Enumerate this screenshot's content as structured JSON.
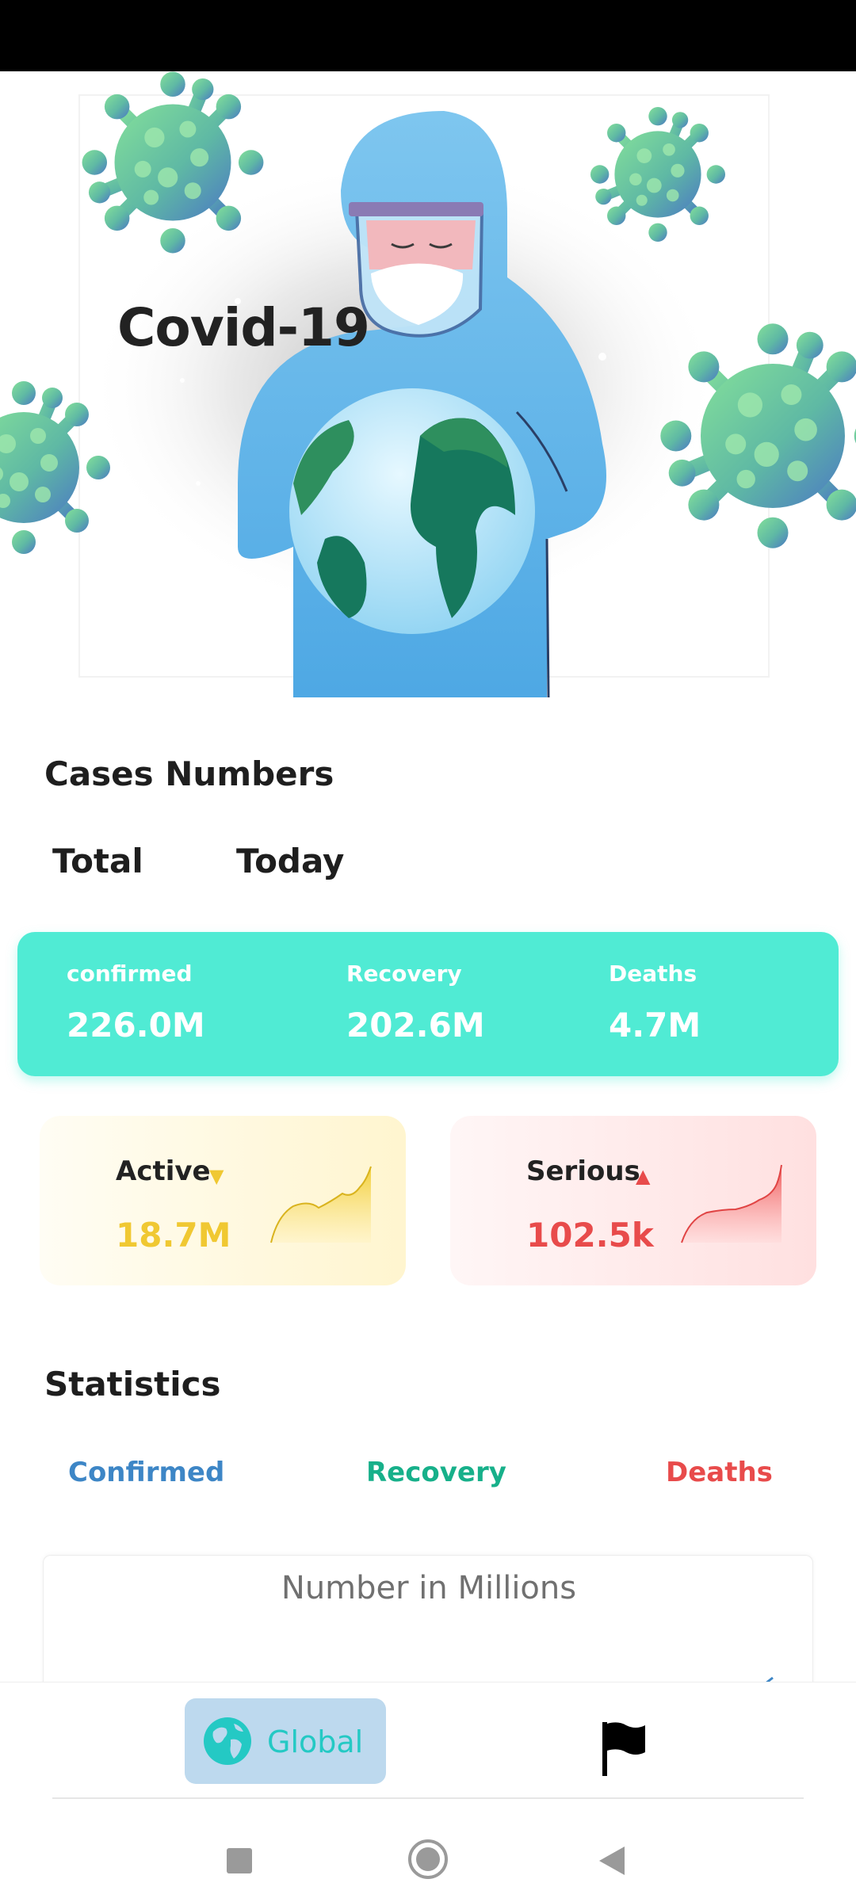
{
  "hero": {
    "title": "Covid-19"
  },
  "cases": {
    "title": "Cases Numbers",
    "tabs": {
      "total": "Total",
      "today": "Today"
    },
    "summary": {
      "confirmed": {
        "label": "confirmed",
        "value": "226.0M"
      },
      "recovery": {
        "label": "Recovery",
        "value": "202.6M"
      },
      "deaths": {
        "label": "Deaths",
        "value": "4.7M"
      }
    },
    "active": {
      "label": "Active",
      "arrow": "▼",
      "value": "18.7M"
    },
    "serious": {
      "label": "Serious",
      "arrow": "▲",
      "value": "102.5k"
    }
  },
  "statistics": {
    "title": "Statistics",
    "tabs": {
      "confirmed": "Confirmed",
      "recovery": "Recovery",
      "deaths": "Deaths"
    },
    "chart_title": "Number in Millions"
  },
  "bottom_nav": {
    "global_label": "Global"
  },
  "colors": {
    "accent": "#50ebd4",
    "active": "#f0c832",
    "serious": "#e84b4b",
    "confirmed": "#3d86c6",
    "recovery": "#17b08a"
  },
  "icons": {
    "global": "globe-icon",
    "country": "flag-icon",
    "recent": "square-icon",
    "home": "circle-icon",
    "back": "triangle-back-icon"
  }
}
